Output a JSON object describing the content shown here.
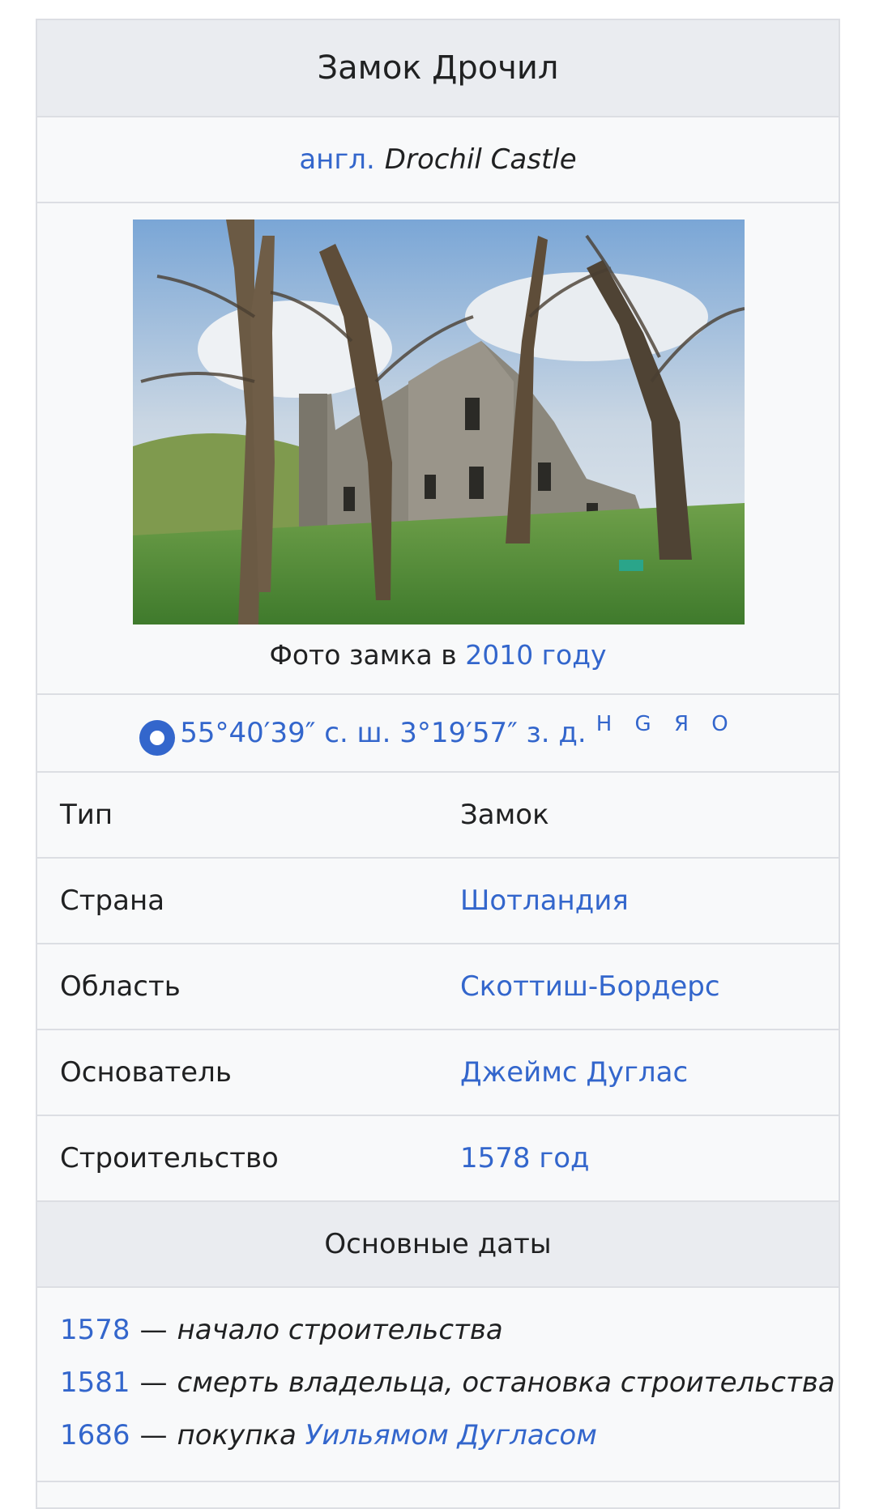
{
  "infobox": {
    "title": "Замок Дрочил",
    "lang_label": "англ.",
    "original_name": "Drochil Castle",
    "caption_text": "Фото замка в",
    "caption_link": "2010 году",
    "coordinates": "55°40′39″ с. ш. 3°19′57″ з. д.",
    "coord_links": [
      "H",
      "G",
      "Я",
      "O"
    ],
    "rows": [
      {
        "label": "Тип",
        "value": "Замок",
        "is_link": false
      },
      {
        "label": "Страна",
        "value": "Шотландия",
        "is_link": true
      },
      {
        "label": "Область",
        "value": "Скоттиш-Бордерс",
        "is_link": true
      },
      {
        "label": "Основатель",
        "value": "Джеймс Дуглас",
        "is_link": true
      },
      {
        "label": "Строительство",
        "value": "1578 год",
        "is_link": true
      }
    ],
    "section_header": "Основные даты",
    "dates": [
      {
        "year": "1578",
        "dash": "—",
        "text": "начало строительства",
        "link": ""
      },
      {
        "year": "1581",
        "dash": "—",
        "text": "смерть владельца, остановка строительства",
        "link": ""
      },
      {
        "year": "1686",
        "dash": "—",
        "text": "покупка",
        "link": "Уильямом Дугласом"
      }
    ]
  },
  "colors": {
    "link": "#3366cc",
    "header_bg": "#eaecf0",
    "box_bg": "#f8f9fa",
    "border": "#dcdee3"
  }
}
